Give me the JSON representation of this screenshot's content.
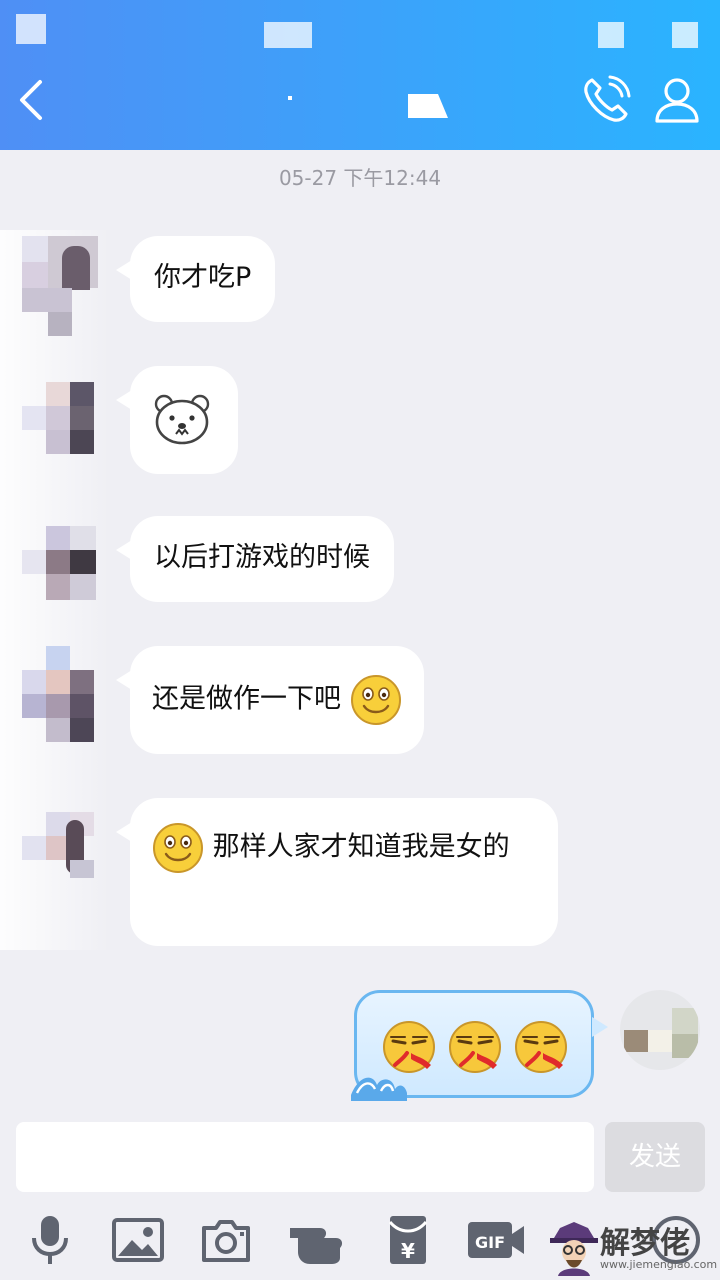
{
  "conversation": {
    "timestamp": "05-27 下午12:44",
    "messages": [
      {
        "from": "other",
        "text": "你才吃P"
      },
      {
        "from": "other",
        "sticker": "bear-face-icon"
      },
      {
        "from": "other",
        "text": "以后打游戏的时候"
      },
      {
        "from": "other",
        "text": "还是做作一下吧",
        "trailing_emoji": "smile-emoji-icon"
      },
      {
        "from": "other",
        "text": "那样人家才知道我是女的",
        "leading_emoji": "smile-emoji-icon"
      },
      {
        "from": "me",
        "emoji": [
          "nosebleed-emoji-icon",
          "nosebleed-emoji-icon",
          "nosebleed-emoji-icon"
        ]
      }
    ]
  },
  "input": {
    "send_label": "发送"
  },
  "toolbar": {
    "items": [
      "microphone-icon",
      "image-icon",
      "camera-icon",
      "poke-icon",
      "red-packet-icon",
      "gif-icon",
      "more-icon"
    ]
  },
  "watermark": {
    "text": "解梦佬",
    "url": "www.jiemenglao.com"
  },
  "colors": {
    "header_start": "#4f8ff5",
    "header_end": "#2ab4ff",
    "background": "#efeff4",
    "bubble": "#ffffff"
  }
}
